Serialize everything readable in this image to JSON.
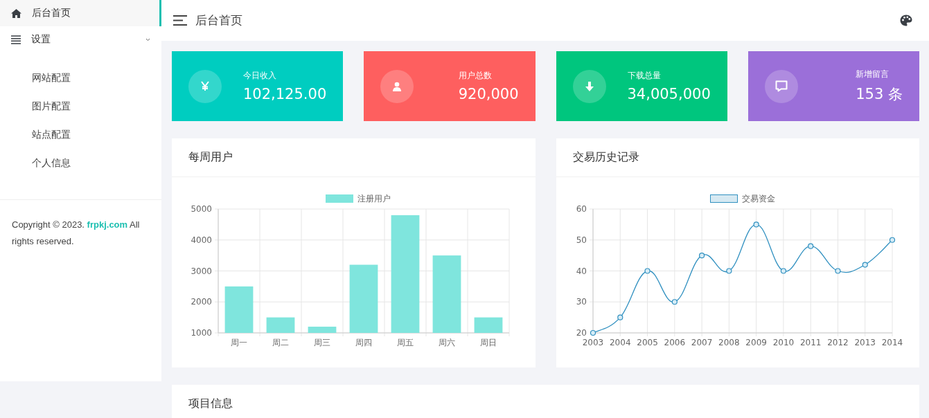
{
  "sidebar": {
    "items": [
      {
        "label": "后台首页",
        "kind": "home",
        "selected": true
      },
      {
        "label": "设置",
        "kind": "list",
        "selected": false,
        "expanded": true,
        "children": [
          {
            "label": "网站配置",
            "selected": false
          },
          {
            "label": "图片配置",
            "selected": false
          },
          {
            "label": "站点配置",
            "selected": false
          },
          {
            "label": "个人信息",
            "selected": false
          }
        ]
      }
    ],
    "footer": {
      "text_before": "Copyright © 2023. ",
      "link": "frpkj.com",
      "text_after": " All rights reserved."
    }
  },
  "header": {
    "title": "后台首页"
  },
  "stats": [
    {
      "label": "今日收入",
      "value": "102,125.00",
      "kind": "yen",
      "color": "#00cdc0"
    },
    {
      "label": "用户总数",
      "value": "920,000",
      "kind": "user",
      "color": "#fe5f5f"
    },
    {
      "label": "下载总量",
      "value": "34,005,000",
      "kind": "download",
      "color": "#00c67e"
    },
    {
      "label": "新增留言",
      "value": "153 条",
      "kind": "message",
      "color": "#9b6fd9"
    }
  ],
  "panels": [
    {
      "title": "每周用户",
      "chart_data": {
        "type": "bar",
        "categories": [
          "周一",
          "周二",
          "周三",
          "周四",
          "周五",
          "周六",
          "周日"
        ],
        "series": [
          {
            "name": "注册用户",
            "color": "#7fe5dd",
            "values": [
              2500,
              1500,
              1200,
              3200,
              4800,
              3500,
              1500
            ]
          }
        ],
        "ylim": [
          1000,
          5000
        ],
        "yticks": [
          1000,
          2000,
          3000,
          4000,
          5000
        ],
        "grid": true
      }
    },
    {
      "title": "交易历史记录",
      "chart_data": {
        "type": "line",
        "categories": [
          "2003",
          "2004",
          "2005",
          "2006",
          "2007",
          "2008",
          "2009",
          "2010",
          "2011",
          "2012",
          "2013",
          "2014"
        ],
        "series": [
          {
            "name": "交易资金",
            "color": "#3090c0",
            "marker": "circle",
            "values": [
              20,
              25,
              40,
              30,
              45,
              40,
              55,
              40,
              48,
              40,
              42,
              50
            ]
          }
        ],
        "ylim": [
          20,
          60
        ],
        "yticks": [
          20,
          30,
          40,
          50,
          60
        ],
        "grid": true
      }
    }
  ],
  "bottom_panel": {
    "title": "项目信息"
  }
}
